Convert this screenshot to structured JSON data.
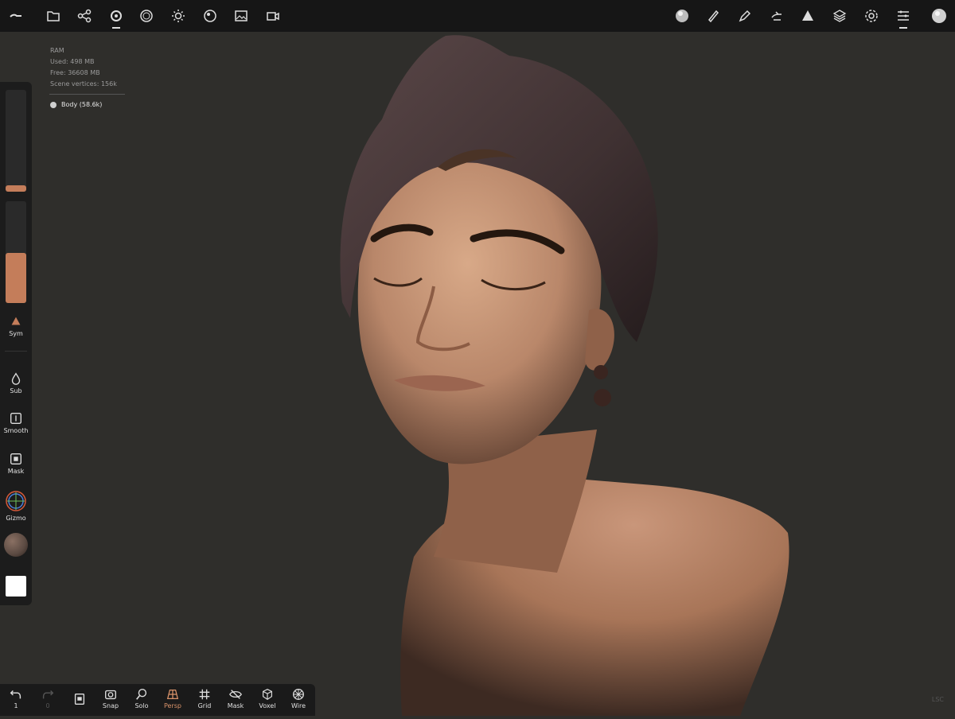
{
  "topbar": {
    "left_icons": [
      "menu-icon",
      "folder-icon",
      "share-icon",
      "scene-icon",
      "topology-icon",
      "light-icon",
      "material-icon",
      "image-icon",
      "camera-icon"
    ],
    "right_icons": [
      "matcap-sphere-icon",
      "brush-icon",
      "pen-icon",
      "hand-icon",
      "triangle-icon",
      "layers-icon",
      "settings-icon",
      "sliders-icon",
      "profile-sphere-icon"
    ]
  },
  "stats": {
    "ram": "RAM",
    "used": "Used: 498 MB",
    "free": "Free: 36608 MB",
    "scene_vertices": "Scene vertices: 156k",
    "object": "Body (58.6k)"
  },
  "left_panel": {
    "radius_fill_pct": 6,
    "intensity_fill_pct": 49,
    "sym_label": "Sym",
    "tools": [
      {
        "label": "Sub",
        "icon": "drop-icon"
      },
      {
        "label": "Smooth",
        "icon": "smooth-icon"
      },
      {
        "label": "Mask",
        "icon": "mask-icon"
      },
      {
        "label": "Gizmo",
        "icon": "gizmo-icon"
      }
    ],
    "material_color": "#5b4a42",
    "color_swatch": "#ffffff"
  },
  "bottom_bar": {
    "undo_count": "1",
    "redo_count": "0",
    "buttons": [
      {
        "label": "Snap",
        "icon": "snap-icon"
      },
      {
        "label": "Solo",
        "icon": "solo-icon"
      },
      {
        "label": "Persp",
        "icon": "perspective-icon",
        "active": true
      },
      {
        "label": "Grid",
        "icon": "grid-icon"
      },
      {
        "label": "Mask",
        "icon": "mask-visibility-icon"
      },
      {
        "label": "Voxel",
        "icon": "voxel-icon"
      },
      {
        "label": "Wire",
        "icon": "wireframe-icon"
      }
    ]
  },
  "colors": {
    "background": "#2f2e2b",
    "accent": "#c47d5a",
    "skin": "#b98466",
    "turban": "#4a3a3b"
  },
  "watermark": "LSC"
}
